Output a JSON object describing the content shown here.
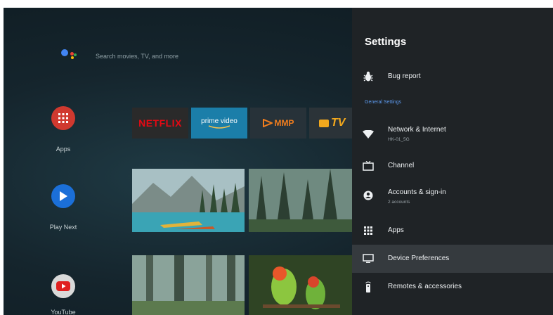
{
  "search": {
    "placeholder": "Search movies, TV, and more"
  },
  "sidebar": {
    "apps_label": "Apps",
    "play_next_label": "Play Next",
    "youtube_label": "YouTube"
  },
  "channels": {
    "netflix": "NETFLIX",
    "prime": "prime video",
    "mmp": "MMP",
    "tv": "TV"
  },
  "settings": {
    "title": "Settings",
    "bug_report": "Bug report",
    "section_general": "General Settings",
    "network": {
      "label": "Network & Internet",
      "sub": "HK-01_5G"
    },
    "channel": "Channel",
    "accounts": {
      "label": "Accounts & sign-in",
      "sub": "2 accounts"
    },
    "apps": "Apps",
    "device_prefs": "Device Preferences",
    "remotes": "Remotes & accessories",
    "selected_item": "Device Preferences"
  },
  "colors": {
    "accent_blue": "#5e9bf0",
    "netflix_red": "#e50914",
    "prime_blue": "#1b7ea9",
    "panel_bg": "#1f2326",
    "selected_bg": "#353a3e"
  }
}
